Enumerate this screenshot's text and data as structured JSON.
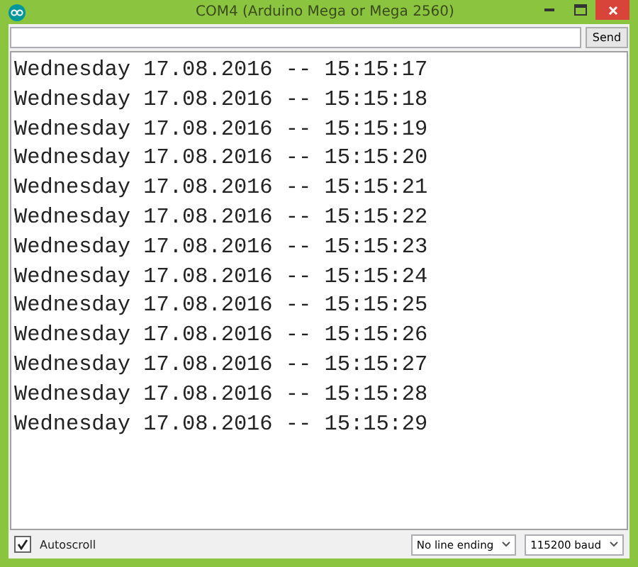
{
  "window": {
    "title": "COM4 (Arduino Mega or Mega 2560)"
  },
  "send_button": "Send",
  "output_lines": [
    "Wednesday 17.08.2016 -- 15:15:17",
    "Wednesday 17.08.2016 -- 15:15:18",
    "Wednesday 17.08.2016 -- 15:15:19",
    "Wednesday 17.08.2016 -- 15:15:20",
    "Wednesday 17.08.2016 -- 15:15:21",
    "Wednesday 17.08.2016 -- 15:15:22",
    "Wednesday 17.08.2016 -- 15:15:23",
    "Wednesday 17.08.2016 -- 15:15:24",
    "Wednesday 17.08.2016 -- 15:15:25",
    "Wednesday 17.08.2016 -- 15:15:26",
    "Wednesday 17.08.2016 -- 15:15:27",
    "Wednesday 17.08.2016 -- 15:15:28",
    "Wednesday 17.08.2016 -- 15:15:29"
  ],
  "autoscroll": {
    "label": "Autoscroll",
    "checked": true
  },
  "line_ending": {
    "value": "No line ending"
  },
  "baud_rate": {
    "value": "115200 baud"
  }
}
